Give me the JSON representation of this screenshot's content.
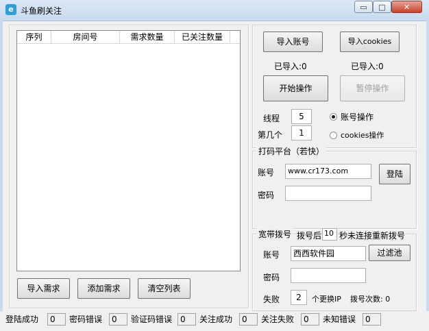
{
  "window": {
    "title": "斗鱼刷关注",
    "app_icon_glyph": "e",
    "minimize": "▭",
    "maximize": "□",
    "close": "✕"
  },
  "list": {
    "columns": [
      "序列",
      "房间号",
      "需求数量",
      "已关注数量"
    ],
    "rows": []
  },
  "left_buttons": {
    "import_demand": "导入需求",
    "add_demand": "添加需求",
    "clear_list": "清空列表"
  },
  "account_panel": {
    "import_account": "导入账号",
    "import_cookies": "导入cookies",
    "imported_account": "已导入:0",
    "imported_cookies": "已导入:0",
    "start": "开始操作",
    "pause": "暂停操作",
    "threads_label": "线程",
    "threads_value": "5",
    "index_label": "第几个",
    "index_value": "1",
    "radio_account": "账号操作",
    "radio_cookies": "cookies操作",
    "radio_selected": "account"
  },
  "captcha": {
    "legend": "打码平台（若快）",
    "account_label": "账号",
    "account_value": "www.cr173.com",
    "password_label": "密码",
    "password_value": "",
    "login": "登陆"
  },
  "dialup": {
    "legend": "宽带拨号",
    "after_label": "拨号后",
    "after_value": "10",
    "after_suffix": "秒未连接重新拨号",
    "account_label": "账号",
    "account_value": "西西软件园",
    "filter_pool": "过滤池",
    "password_label": "密码",
    "password_value": "",
    "fail_label": "失败",
    "fail_value": "2",
    "fail_suffix": "个更换IP",
    "dial_count": "拨号次数: 0"
  },
  "status_bar": [
    {
      "label": "登陆成功",
      "value": "0"
    },
    {
      "label": "密码错误",
      "value": "0"
    },
    {
      "label": "验证码错误",
      "value": "0"
    },
    {
      "label": "关注成功",
      "value": "0"
    },
    {
      "label": "关注失败",
      "value": "0"
    },
    {
      "label": "未知错误",
      "value": "0"
    }
  ]
}
